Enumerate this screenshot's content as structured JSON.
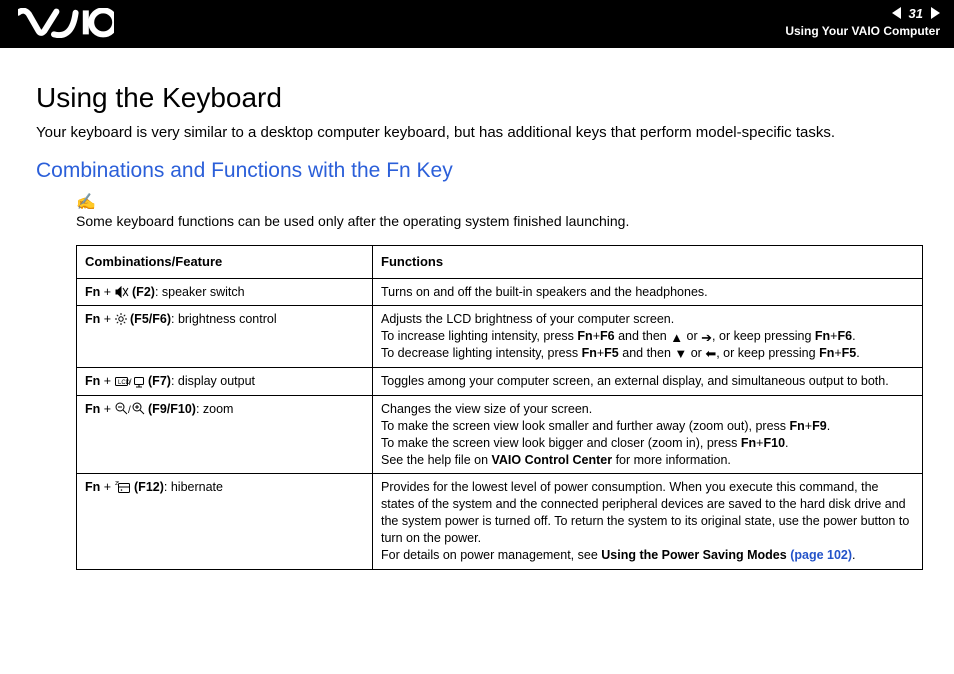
{
  "header": {
    "page_number": "31",
    "section": "Using Your VAIO Computer"
  },
  "page": {
    "title": "Using the Keyboard",
    "intro": "Your keyboard is very similar to a desktop computer keyboard, but has additional keys that perform model-specific tasks.",
    "subtitle": "Combinations and Functions with the Fn Key",
    "note": "Some keyboard functions can be used only after the operating system finished launching."
  },
  "table": {
    "headers": {
      "col1": "Combinations/Feature",
      "col2": "Functions"
    },
    "rows": [
      {
        "combo": {
          "prefix": "Fn",
          "plus": " + ",
          "key": "(F2)",
          "label": ": speaker switch",
          "icon": "speaker-mute-icon"
        },
        "func_simple": "Turns on and off the built-in speakers and the headphones."
      },
      {
        "combo": {
          "prefix": "Fn",
          "plus": " + ",
          "key": "(F5/F6)",
          "label": ": brightness control",
          "icon": "brightness-icon"
        },
        "func_lines": {
          "l1": "Adjusts the LCD brightness of your computer screen.",
          "l2a": "To increase lighting intensity, press ",
          "l2b": "Fn",
          "l2c": "+",
          "l2d": "F6",
          "l2e": " and then ",
          "l2f": " or ",
          "l2g": ", or keep pressing ",
          "l2h": "Fn",
          "l2i": "+",
          "l2j": "F6",
          "l2k": ".",
          "l3a": "To decrease lighting intensity, press ",
          "l3b": "Fn",
          "l3c": "+",
          "l3d": "F5",
          "l3e": " and then ",
          "l3f": " or ",
          "l3g": ", or keep pressing ",
          "l3h": "Fn",
          "l3i": "+",
          "l3j": "F5",
          "l3k": "."
        }
      },
      {
        "combo": {
          "prefix": "Fn",
          "plus": " + ",
          "key": "(F7)",
          "label": ": display output",
          "icon": "display-output-icon"
        },
        "func_simple": "Toggles among your computer screen, an external display, and simultaneous output to both."
      },
      {
        "combo": {
          "prefix": "Fn",
          "plus": " + ",
          "key": "(F9/F10)",
          "label": ": zoom",
          "icon": "zoom-icon"
        },
        "func_lines": {
          "l1": "Changes the view size of your screen.",
          "l2a": "To make the screen view look smaller and further away (zoom out), press ",
          "l2b": "Fn",
          "l2c": "+",
          "l2d": "F9",
          "l2e": ".",
          "l3a": "To make the screen view look bigger and closer (zoom in), press ",
          "l3b": "Fn",
          "l3c": "+",
          "l3d": "F10",
          "l3e": ".",
          "l4a": "See the help file on ",
          "l4b": "VAIO Control Center",
          "l4c": " for more information."
        }
      },
      {
        "combo": {
          "prefix": "Fn",
          "plus": " + ",
          "key": "(F12)",
          "label": ": hibernate",
          "icon": "hibernate-icon"
        },
        "func_lines": {
          "l1": "Provides for the lowest level of power consumption. When you execute this command, the states of the system and the connected peripheral devices are saved to the hard disk drive and the system power is turned off. To return the system to its original state, use the power button to turn on the power.",
          "l2a": "For details on power management, see ",
          "l2b": "Using the Power Saving Modes ",
          "l2c": "(page 102)",
          "l2d": "."
        }
      }
    ]
  }
}
